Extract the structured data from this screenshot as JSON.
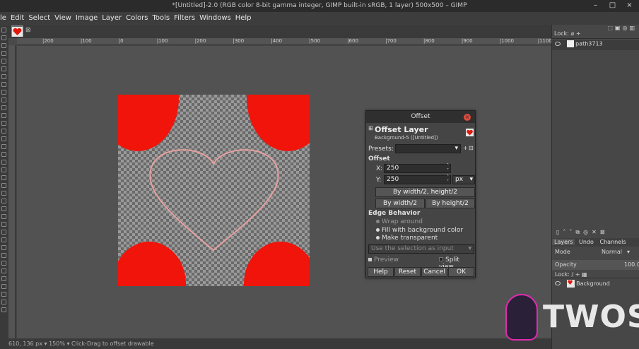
{
  "window": {
    "title": "*[Untitled]-2.0 (RGB color 8-bit gamma integer, GIMP built-in sRGB, 1 layer) 500x500 – GIMP",
    "ctrl_minimize": "–",
    "ctrl_maximize": "□",
    "ctrl_close": "×"
  },
  "menubar": {
    "items": [
      "le",
      "Edit",
      "Select",
      "View",
      "Image",
      "Layer",
      "Colors",
      "Tools",
      "Filters",
      "Windows",
      "Help"
    ]
  },
  "image_tab": {
    "close": "⊠"
  },
  "ruler": {
    "labels": [
      "|200",
      "|100",
      "|0",
      "|100",
      "|200",
      "|300",
      "|400",
      "|500",
      "|600",
      "|700",
      "|800",
      "|900",
      "|1000",
      "|1100"
    ]
  },
  "statusbar": {
    "text": "610, 136    px ▾  150% ▾  Click-Drag to offset drawable"
  },
  "paths_panel": {
    "lock_label": "Lock:",
    "row_name": "path3713"
  },
  "tabs": {
    "layers": "Layers",
    "undo": "Undo",
    "channels": "Channels"
  },
  "layers_panel": {
    "mode_label": "Mode",
    "mode_value": "Normal",
    "opacity_label": "Opacity",
    "opacity_value": "100.0",
    "lock_label": "Lock:",
    "layer_name": "Background"
  },
  "dialog": {
    "title": "Offset",
    "close": "×",
    "heading": "Offset Layer",
    "subheading": "Background-5 ([Untitled])",
    "presets_label": "Presets:",
    "offset_section": "Offset",
    "x_label": "X:",
    "x_value": "250",
    "y_label": "Y:",
    "y_value": "250",
    "unit": "px",
    "btn_half_both": "By width/2, height/2",
    "btn_half_width": "By width/2",
    "btn_half_height": "By height/2",
    "edge_section": "Edge Behavior",
    "opt_wrap": "Wrap around",
    "opt_fill": "Fill with background color",
    "opt_transparent": "Make transparent",
    "selection_input": "Use the selection as input",
    "preview": "Preview",
    "split_view": "Split view",
    "btn_help": "Help",
    "btn_reset": "Reset",
    "btn_cancel": "Cancel",
    "btn_ok": "OK"
  },
  "watermark": {
    "text": "TWOS"
  }
}
